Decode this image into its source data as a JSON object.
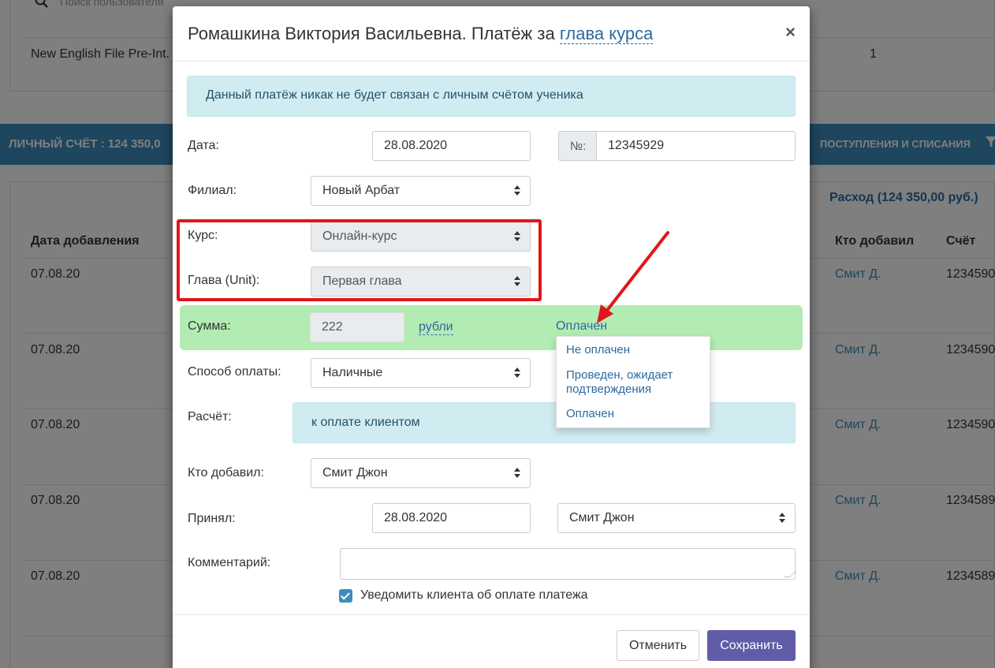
{
  "background": {
    "search_placeholder": "Поиск пользователя",
    "course_row": {
      "name": "New English File Pre-Int.",
      "count": "1"
    },
    "account_bar": {
      "title": "ЛИЧНЫЙ СЧЁТ :  124 350,0",
      "ops_label": "ПОСТУПЛЕНИЯ И СПИСАНИЯ"
    },
    "expense_label": "Расход (124 350,00 руб.)",
    "table_headers": {
      "date_added": "Дата добавления",
      "who_added": "Кто добавил",
      "account": "Счёт"
    },
    "rows": [
      {
        "date": "07.08.20",
        "who": "Смит Д.",
        "account": "1234590"
      },
      {
        "date": "07.08.20",
        "who": "Смит Д.",
        "account": "1234590"
      },
      {
        "date": "07.08.20",
        "who": "Смит Д.",
        "account": "1234590"
      },
      {
        "date": "07.08.20",
        "who": "Смит Д.",
        "account": "1234589"
      },
      {
        "date": "07.08.20",
        "who": "Смит Д.",
        "account": "1234589"
      }
    ]
  },
  "modal": {
    "title_prefix": "Ромашкина Виктория Васильевна. Платёж за ",
    "title_link": "глава курса",
    "close": "×",
    "info_alert": "Данный платёж никак не будет связан с личным счётом ученика",
    "fields": {
      "date_label": "Дата:",
      "date_value": "28.08.2020",
      "number_addon": "№:",
      "number_value": "12345929",
      "branch_label": "Филиал:",
      "branch_value": "Новый Арбат",
      "course_label": "Курс:",
      "course_value": "Онлайн-курс",
      "unit_label": "Глава (Unit):",
      "unit_value": "Первая глава",
      "sum_label": "Сумма:",
      "sum_value": "222",
      "currency": "рубли",
      "status": "Оплачен",
      "payment_method_label": "Способ оплаты:",
      "payment_method_value": "Наличные",
      "calc_label": "Расчёт:",
      "calc_value": "к оплате клиентом",
      "added_by_label": "Кто добавил:",
      "added_by_value": "Смит Джон",
      "accepted_label": "Принял:",
      "accepted_date": "28.08.2020",
      "accepted_by": "Смит Джон",
      "comment_label": "Комментарий:",
      "comment_value": "",
      "notify_label": "Уведомить клиента об оплате платежа"
    },
    "status_dropdown": [
      "Не оплачен",
      "Проведен, ожидает подтверждения",
      "Оплачен"
    ],
    "buttons": {
      "cancel": "Отменить",
      "save": "Сохранить"
    }
  },
  "colors": {
    "primary": "#3c8dbc",
    "save_button": "#605ca8",
    "highlight_green": "#b3ecb3",
    "annotation_red": "#e0161c"
  }
}
